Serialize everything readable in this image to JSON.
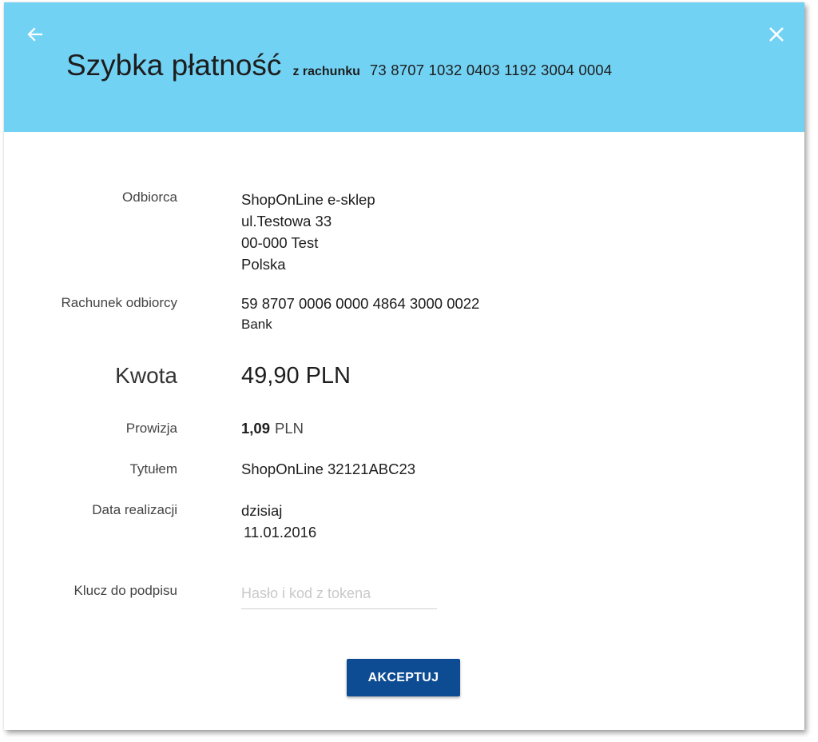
{
  "header": {
    "title": "Szybka płatność",
    "from_label": "z rachunku",
    "from_account": "73 8707 1032 0403 1192 3004 0004",
    "colors": {
      "background": "#72d2f4"
    },
    "icons": {
      "back": "arrow-left-icon",
      "close": "close-icon"
    }
  },
  "details": {
    "recipient": {
      "label": "Odbiorca",
      "lines": [
        "ShopOnLine e-sklep",
        "ul.Testowa 33",
        "00-000 Test",
        "Polska"
      ]
    },
    "recipient_account": {
      "label": "Rachunek odbiorcy",
      "number": "59 8707 0006 0000 4864 3000 0022",
      "bank": "Bank"
    },
    "amount": {
      "label": "Kwota",
      "value": "49,90",
      "currency": "PLN"
    },
    "fee": {
      "label": "Prowizja",
      "value": "1,09",
      "currency": "PLN"
    },
    "title": {
      "label": "Tytułem",
      "value": "ShopOnLine 32121ABC23"
    },
    "date": {
      "label": "Data realizacji",
      "value": "dzisiaj",
      "date": "11.01.2016"
    },
    "signature": {
      "label": "Klucz do podpisu",
      "placeholder": "Hasło i kod z tokena",
      "value": ""
    }
  },
  "actions": {
    "accept_label": "AKCEPTUJ",
    "colors": {
      "accept": "#0d4c92"
    }
  }
}
